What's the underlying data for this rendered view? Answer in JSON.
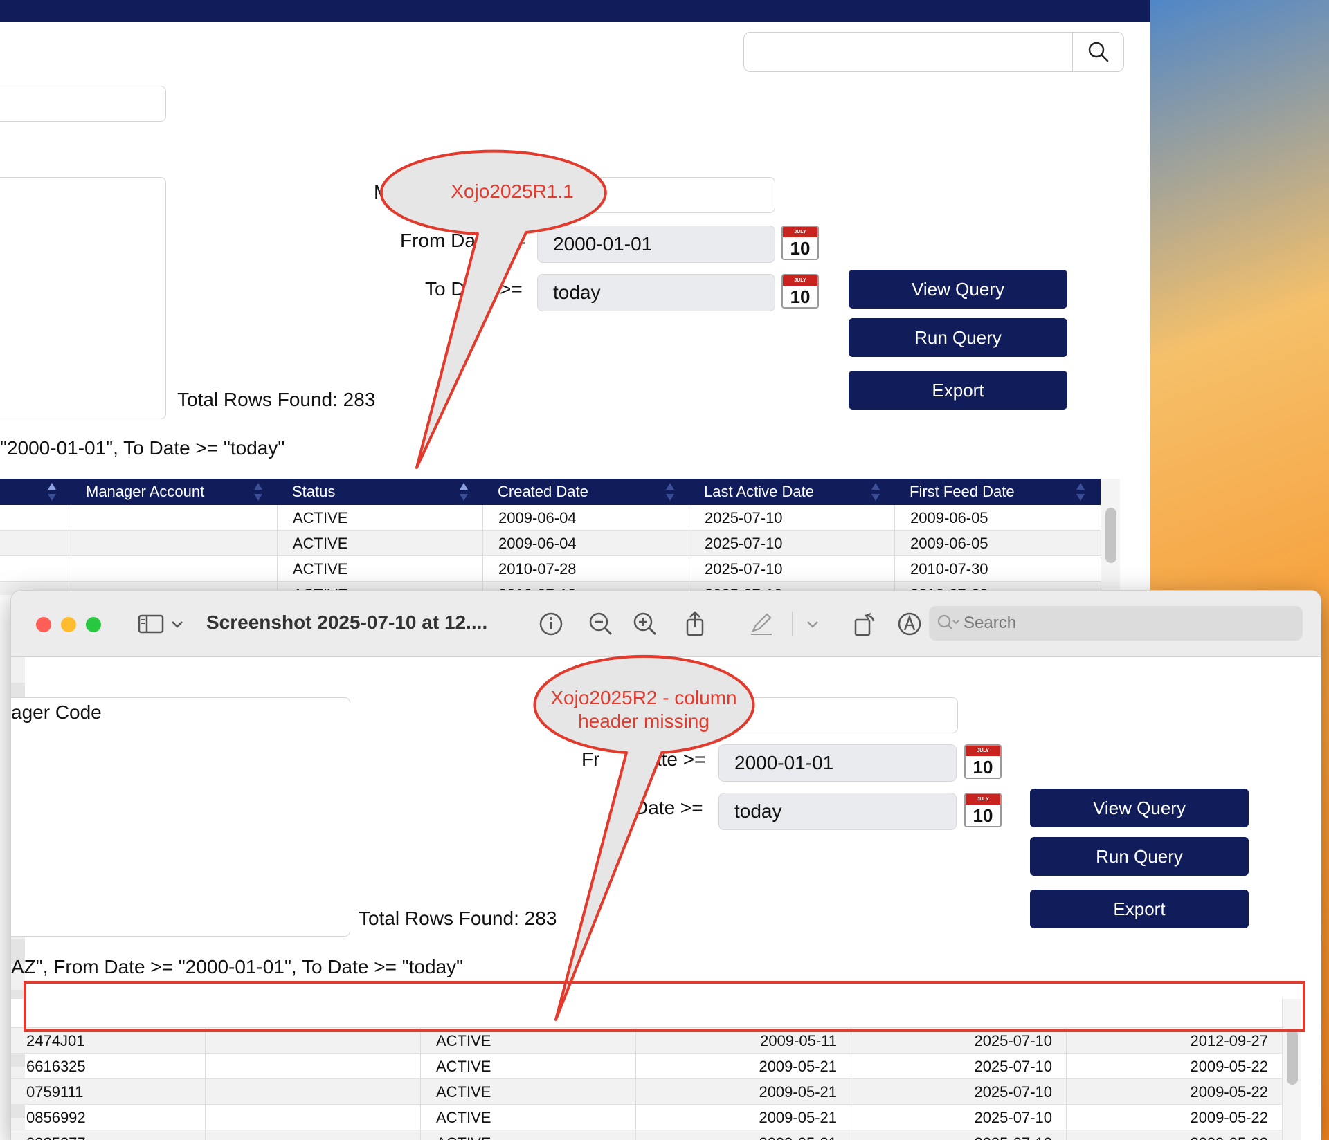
{
  "window_a": {
    "from_date_label": "From Da",
    "from_date_suffix": "=",
    "to_date_label": "To D",
    "to_date_suffix": ">=",
    "manager_label": "Ma",
    "from_date_value": "2000-01-01",
    "to_date_value": "today",
    "calendar_month": "JULY",
    "calendar_day": "10",
    "view_query": "View Query",
    "run_query": "Run Query",
    "export": "Export",
    "total_rows": "Total Rows Found: 283",
    "query_summary": "\"2000-01-01\", To Date >= \"today\"",
    "columns": [
      "Manager Account",
      "Status",
      "Created Date",
      "Last Active Date",
      "First Feed Date"
    ],
    "rows": [
      [
        "",
        "ACTIVE",
        "2009-06-04",
        "2025-07-10",
        "2009-06-05"
      ],
      [
        "",
        "ACTIVE",
        "2009-06-04",
        "2025-07-10",
        "2009-06-05"
      ],
      [
        "",
        "ACTIVE",
        "2010-07-28",
        "2025-07-10",
        "2010-07-30"
      ],
      [
        "",
        "ACTIVE",
        "2010-07-10",
        "2025-07-10",
        "2010-07-20"
      ]
    ]
  },
  "window_b": {
    "title": "Screenshot 2025-07-10 at 12....",
    "search_placeholder": "Search",
    "manager_code_label": "ager Code",
    "manager_value": "Z",
    "from_date_label": "Fr",
    "from_date_suffix": "ate >=",
    "to_date_label": "Date >=",
    "from_date_value": "2000-01-01",
    "to_date_value": "today",
    "calendar_month": "JULY",
    "calendar_day": "10",
    "view_query": "View Query",
    "run_query": "Run Query",
    "export": "Export",
    "total_rows": "Total Rows Found: 283",
    "query_summary": "AZ\", From Date >= \"2000-01-01\", To Date >= \"today\"",
    "rows": [
      [
        "2474J01",
        "",
        "ACTIVE",
        "2009-05-11",
        "2025-07-10",
        "2012-09-27"
      ],
      [
        "6616325",
        "",
        "ACTIVE",
        "2009-05-21",
        "2025-07-10",
        "2009-05-22"
      ],
      [
        "0759111",
        "",
        "ACTIVE",
        "2009-05-21",
        "2025-07-10",
        "2009-05-22"
      ],
      [
        "0856992",
        "",
        "ACTIVE",
        "2009-05-21",
        "2025-07-10",
        "2009-05-22"
      ],
      [
        "0935877",
        "",
        "ACTIVE",
        "2009-05-21",
        "2025-07-10",
        "2009-05-22"
      ]
    ]
  },
  "annotations": {
    "callout_1": "Xojo2025R1.1",
    "callout_2_line1": "Xojo2025R2 - column",
    "callout_2_line2": "header missing"
  },
  "colors": {
    "navy": "#111d5a",
    "annotation_red": "#e23a2c"
  }
}
